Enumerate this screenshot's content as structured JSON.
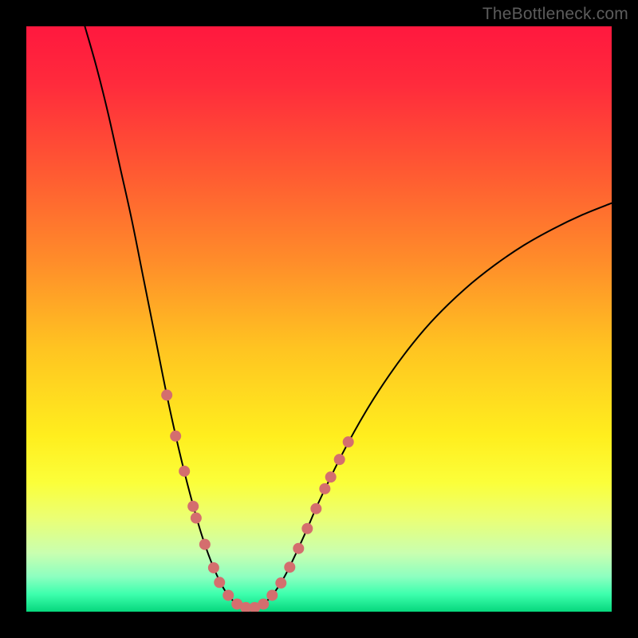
{
  "watermark": "TheBottleneck.com",
  "chart_data": {
    "type": "line",
    "title": "",
    "xlabel": "",
    "ylabel": "",
    "xlim": [
      0,
      100
    ],
    "ylim": [
      0,
      100
    ],
    "grid": false,
    "legend": false,
    "background": {
      "type": "vertical-gradient",
      "stops": [
        {
          "offset": 0.0,
          "color": "#ff183e"
        },
        {
          "offset": 0.1,
          "color": "#ff2b3c"
        },
        {
          "offset": 0.25,
          "color": "#ff5a32"
        },
        {
          "offset": 0.4,
          "color": "#ff8c2a"
        },
        {
          "offset": 0.55,
          "color": "#ffc421"
        },
        {
          "offset": 0.7,
          "color": "#ffee1e"
        },
        {
          "offset": 0.78,
          "color": "#fbff3a"
        },
        {
          "offset": 0.84,
          "color": "#ebff74"
        },
        {
          "offset": 0.9,
          "color": "#c9ffb0"
        },
        {
          "offset": 0.94,
          "color": "#8dffc0"
        },
        {
          "offset": 0.97,
          "color": "#3dffad"
        },
        {
          "offset": 1.0,
          "color": "#06d77d"
        }
      ]
    },
    "series": [
      {
        "name": "bottleneck-curve",
        "color": "#000000",
        "points": [
          {
            "x": 10.0,
            "y": 100.0
          },
          {
            "x": 12.0,
            "y": 93.0
          },
          {
            "x": 14.0,
            "y": 85.0
          },
          {
            "x": 16.0,
            "y": 76.0
          },
          {
            "x": 18.0,
            "y": 67.0
          },
          {
            "x": 20.0,
            "y": 57.0
          },
          {
            "x": 22.0,
            "y": 47.0
          },
          {
            "x": 24.0,
            "y": 37.0
          },
          {
            "x": 26.0,
            "y": 28.0
          },
          {
            "x": 28.0,
            "y": 20.0
          },
          {
            "x": 30.0,
            "y": 13.0
          },
          {
            "x": 32.0,
            "y": 7.5
          },
          {
            "x": 34.0,
            "y": 3.5
          },
          {
            "x": 36.0,
            "y": 1.3
          },
          {
            "x": 38.0,
            "y": 0.6
          },
          {
            "x": 40.0,
            "y": 1.0
          },
          {
            "x": 42.0,
            "y": 2.8
          },
          {
            "x": 44.0,
            "y": 5.8
          },
          {
            "x": 46.0,
            "y": 9.8
          },
          {
            "x": 48.0,
            "y": 14.2
          },
          {
            "x": 50.0,
            "y": 18.8
          },
          {
            "x": 54.0,
            "y": 27.0
          },
          {
            "x": 58.0,
            "y": 34.2
          },
          {
            "x": 62.0,
            "y": 40.4
          },
          {
            "x": 66.0,
            "y": 45.8
          },
          {
            "x": 70.0,
            "y": 50.4
          },
          {
            "x": 75.0,
            "y": 55.2
          },
          {
            "x": 80.0,
            "y": 59.2
          },
          {
            "x": 85.0,
            "y": 62.6
          },
          {
            "x": 90.0,
            "y": 65.4
          },
          {
            "x": 95.0,
            "y": 67.8
          },
          {
            "x": 100.0,
            "y": 69.8
          }
        ]
      }
    ],
    "highlight": {
      "name": "bottleneck-range-markers",
      "color": "#d46e6e",
      "points": [
        {
          "x": 24.0,
          "y": 37.0
        },
        {
          "x": 25.5,
          "y": 30.0
        },
        {
          "x": 27.0,
          "y": 24.0
        },
        {
          "x": 28.5,
          "y": 18.0
        },
        {
          "x": 29.0,
          "y": 16.0
        },
        {
          "x": 30.5,
          "y": 11.5
        },
        {
          "x": 32.0,
          "y": 7.5
        },
        {
          "x": 33.0,
          "y": 5.0
        },
        {
          "x": 34.5,
          "y": 2.8
        },
        {
          "x": 36.0,
          "y": 1.3
        },
        {
          "x": 37.5,
          "y": 0.7
        },
        {
          "x": 39.0,
          "y": 0.7
        },
        {
          "x": 40.5,
          "y": 1.3
        },
        {
          "x": 42.0,
          "y": 2.8
        },
        {
          "x": 43.5,
          "y": 4.9
        },
        {
          "x": 45.0,
          "y": 7.6
        },
        {
          "x": 46.5,
          "y": 10.8
        },
        {
          "x": 48.0,
          "y": 14.2
        },
        {
          "x": 49.5,
          "y": 17.6
        },
        {
          "x": 51.0,
          "y": 21.0
        },
        {
          "x": 52.0,
          "y": 23.0
        },
        {
          "x": 53.5,
          "y": 26.0
        },
        {
          "x": 55.0,
          "y": 29.0
        }
      ]
    }
  }
}
